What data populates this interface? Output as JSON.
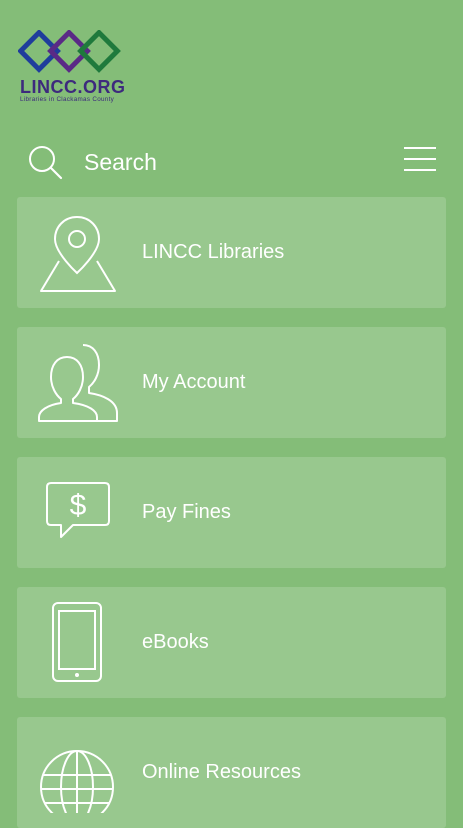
{
  "logo": {
    "title": "LINCC.ORG",
    "subtitle": "Libraries in Clackamas County"
  },
  "search": {
    "label": "Search",
    "icon": "search-icon",
    "menu_icon": "hamburger-menu-icon"
  },
  "tiles": [
    {
      "label": "LINCC Libraries",
      "icon": "map-pin-icon"
    },
    {
      "label": "My Account",
      "icon": "users-icon"
    },
    {
      "label": "Pay Fines",
      "icon": "dollar-chat-icon"
    },
    {
      "label": "eBooks",
      "icon": "phone-icon"
    },
    {
      "label": "Online Resources",
      "icon": "globe-icon"
    }
  ],
  "colors": {
    "background": "#84bd78",
    "tile": "#98c88e",
    "text": "#ffffff",
    "logo_text": "#3d2a7d"
  }
}
